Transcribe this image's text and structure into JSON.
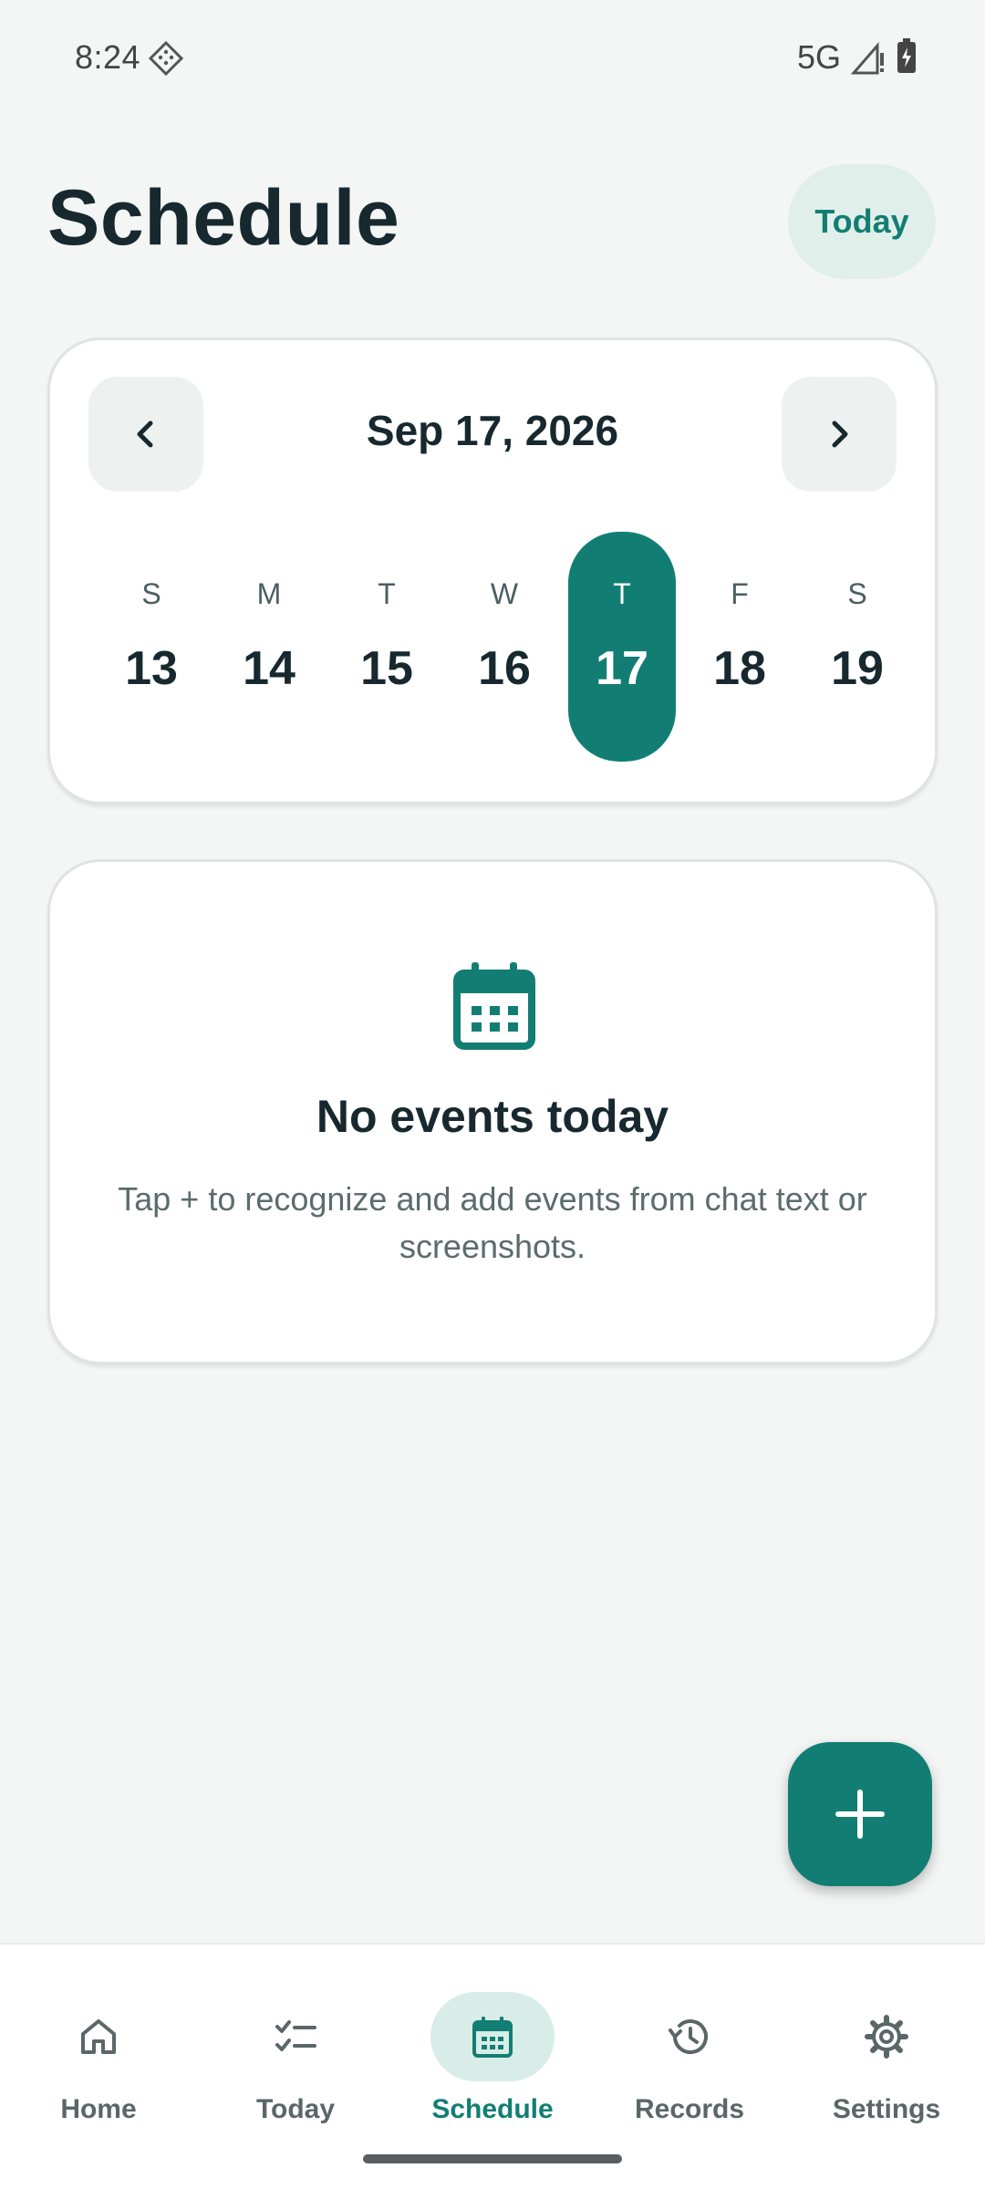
{
  "status_bar": {
    "time": "8:24",
    "network": "5G"
  },
  "header": {
    "title": "Schedule",
    "today_button": "Today"
  },
  "calendar": {
    "month_label": "Sep 17, 2026",
    "days": [
      {
        "letter": "S",
        "number": "13",
        "selected": false
      },
      {
        "letter": "M",
        "number": "14",
        "selected": false
      },
      {
        "letter": "T",
        "number": "15",
        "selected": false
      },
      {
        "letter": "W",
        "number": "16",
        "selected": false
      },
      {
        "letter": "T",
        "number": "17",
        "selected": true
      },
      {
        "letter": "F",
        "number": "18",
        "selected": false
      },
      {
        "letter": "S",
        "number": "19",
        "selected": false
      }
    ]
  },
  "empty_state": {
    "icon": "calendar-icon",
    "title": "No events today",
    "description": "Tap + to recognize and add events from chat text or screenshots."
  },
  "fab": {
    "icon": "plus-icon"
  },
  "bottom_nav": {
    "items": [
      {
        "label": "Home",
        "icon": "home-icon",
        "active": false
      },
      {
        "label": "Today",
        "icon": "checklist-icon",
        "active": false
      },
      {
        "label": "Schedule",
        "icon": "calendar-icon",
        "active": true
      },
      {
        "label": "Records",
        "icon": "history-icon",
        "active": false
      },
      {
        "label": "Settings",
        "icon": "gear-icon",
        "active": false
      }
    ]
  },
  "colors": {
    "accent": "#127e73",
    "background": "#f3f6f4",
    "title_text": "#17282f"
  }
}
